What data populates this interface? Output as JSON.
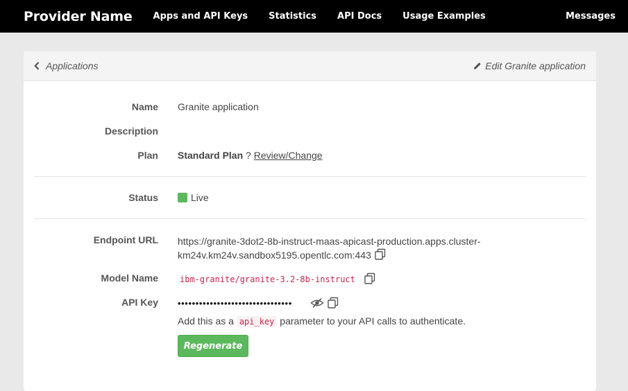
{
  "nav": {
    "brand": "Provider Name",
    "links": [
      "Apps and API Keys",
      "Statistics",
      "API Docs",
      "Usage Examples"
    ],
    "right": "Messages"
  },
  "header": {
    "back_label": "Applications",
    "edit_label": "Edit Granite application"
  },
  "details": {
    "name_label": "Name",
    "name_value": "Granite application",
    "description_label": "Description",
    "plan_label": "Plan",
    "plan_value": "Standard Plan",
    "plan_q": "?",
    "plan_link": "Review/Change",
    "status_label": "Status",
    "status_value": "Live",
    "status_color": "#5cb85c",
    "endpoint_label": "Endpoint URL",
    "endpoint_line1": "https://granite-3dot2-8b-instruct-maas-apicast-production.apps.cluster-",
    "endpoint_line2": "km24v.km24v.sandbox5195.opentlc.com:443",
    "model_label": "Model Name",
    "model_value": "ibm-granite/granite-3.2-8b-instruct",
    "apikey_label": "API Key",
    "apikey_masked": "••••••••••••••••••••••••••••••••",
    "help_prefix": "Add this as a",
    "help_code": "api_key",
    "help_suffix": "parameter to your API calls to authenticate.",
    "regenerate": "Regenerate"
  },
  "colors": {
    "nav_bg": "#000000",
    "page_bg": "#e9e9e9",
    "accent_green": "#5cb85c",
    "code_color": "#c7254e"
  }
}
